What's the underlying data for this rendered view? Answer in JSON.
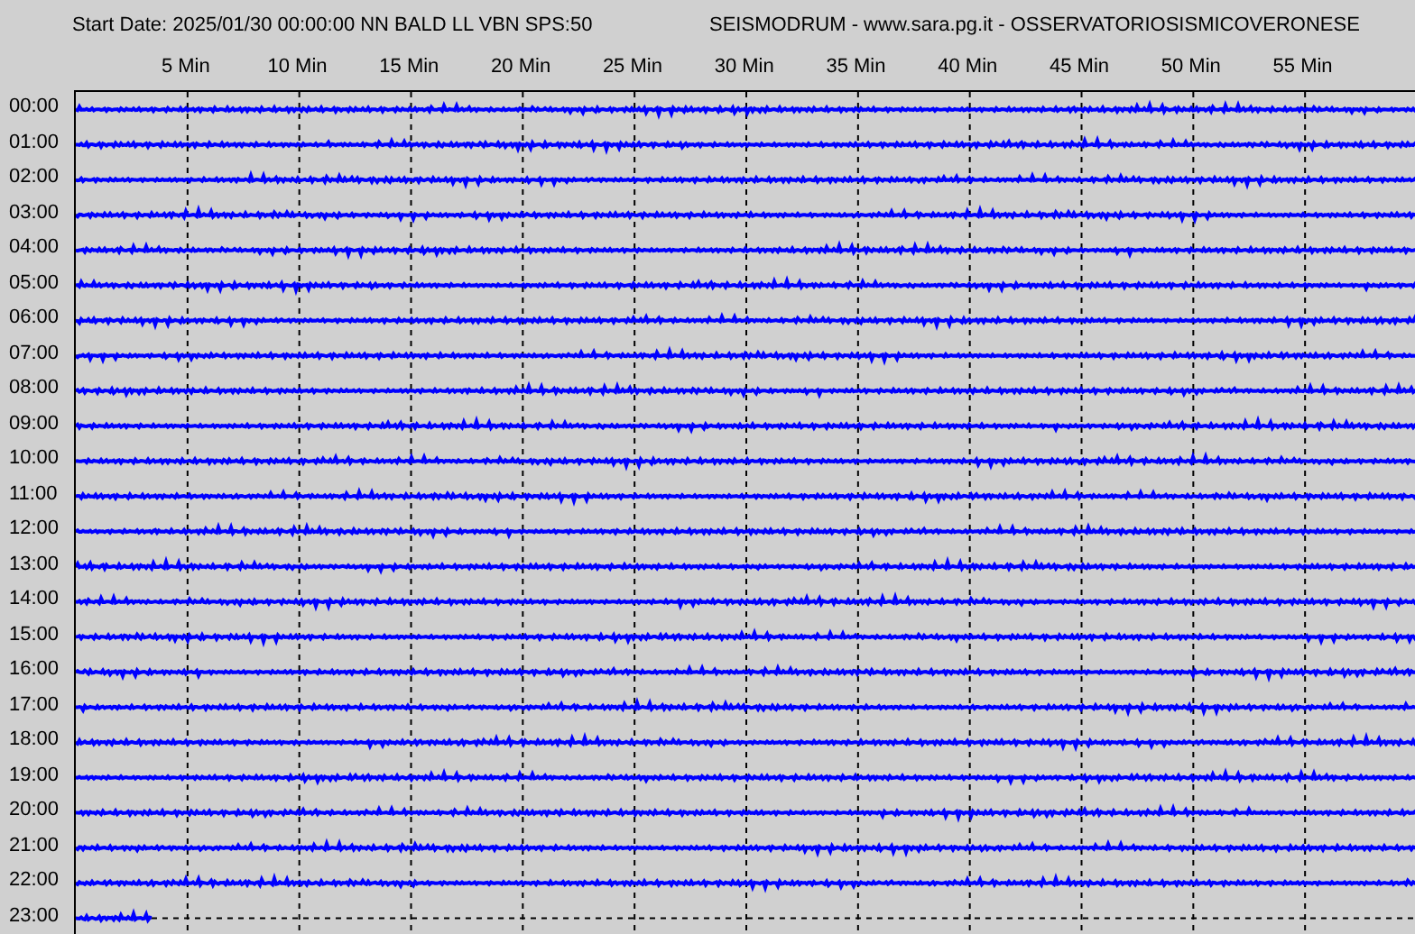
{
  "header": {
    "title": "Start Date: 2025/01/30 00:00:00 NN BALD LL VBN SPS:50",
    "station": "SEISMODRUM - www.sara.pg.it - OSSERVATORIOSISMICOVERONESE"
  },
  "minute_ticks": [
    "5 Min",
    "10 Min",
    "15 Min",
    "20 Min",
    "25 Min",
    "30 Min",
    "35 Min",
    "40 Min",
    "45 Min",
    "50 Min",
    "55 Min"
  ],
  "rows": [
    {
      "hour": "00:00",
      "level": 1
    },
    {
      "hour": "01:00",
      "level": 1
    },
    {
      "hour": "02:00",
      "level": 1
    },
    {
      "hour": "03:00",
      "level": 1
    },
    {
      "hour": "04:00",
      "level": 1
    },
    {
      "hour": "05:00",
      "level": 1
    },
    {
      "hour": "06:00",
      "level": 1
    },
    {
      "hour": "07:00",
      "level": 1
    },
    {
      "hour": "08:00",
      "level": 1
    },
    {
      "hour": "09:00",
      "level": 1
    },
    {
      "hour": "10:00",
      "level": 1
    },
    {
      "hour": "11:00",
      "level": 1
    },
    {
      "hour": "12:00",
      "level": 1
    },
    {
      "hour": "13:00",
      "level": 1
    },
    {
      "hour": "14:00",
      "level": 1
    },
    {
      "hour": "15:00",
      "level": 1
    },
    {
      "hour": "16:00",
      "level": 1
    },
    {
      "hour": "17:00",
      "level": 1
    },
    {
      "hour": "18:00",
      "level": 1
    },
    {
      "hour": "19:00",
      "level": 1
    },
    {
      "hour": "20:00",
      "level": 1
    },
    {
      "hour": "21:00",
      "level": 1
    },
    {
      "hour": "22:00",
      "level": 1
    },
    {
      "hour": "23:00",
      "level": 0.057
    }
  ]
}
